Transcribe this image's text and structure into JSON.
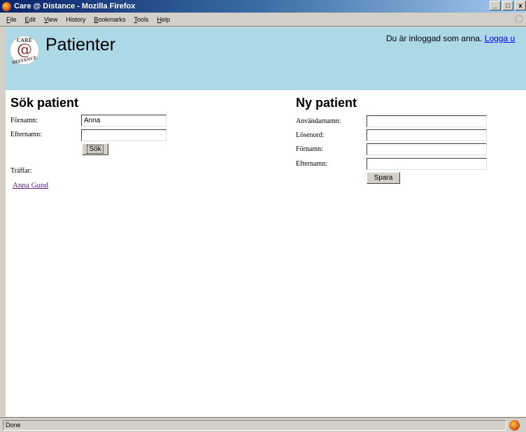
{
  "window": {
    "title": "Care @ Distance - Mozilla Firefox",
    "controls": [
      "_",
      "□",
      "x"
    ]
  },
  "menu": [
    {
      "label": "File",
      "key": "F",
      "rest": "ile"
    },
    {
      "label": "Edit",
      "key": "E",
      "rest": "dit"
    },
    {
      "label": "View",
      "key": "V",
      "rest": "iew"
    },
    {
      "label": "History",
      "key": "",
      "rest": "History"
    },
    {
      "label": "Bookmarks",
      "key": "B",
      "rest": "ookmarks"
    },
    {
      "label": "Tools",
      "key": "T",
      "rest": "ools"
    },
    {
      "label": "Help",
      "key": "H",
      "rest": "elp"
    }
  ],
  "header": {
    "logo_top": "CARE",
    "logo_symbol": "@",
    "logo_bottom": "DISTANCE",
    "title": "Patienter",
    "login_text": "Du är inloggad som anna.",
    "logout_link": "Logga u"
  },
  "search": {
    "heading": "Sök patient",
    "firstname_label": "Förnamn:",
    "firstname_value": "Anna",
    "lastname_label": "Efternamn:",
    "lastname_value": "",
    "button": "Sök",
    "results_label": "Träffar:",
    "results": [
      "Anna Gund"
    ]
  },
  "new_patient": {
    "heading": "Ny patient",
    "username_label": "Användarnamn:",
    "password_label": "Lösenord:",
    "firstname_label": "Förnamn:",
    "lastname_label": "Efternamn:",
    "button": "Spara"
  },
  "status": {
    "text": "Done"
  },
  "colors": {
    "header_bg": "#add8e6",
    "title_bar": "#0a246a",
    "link": "#0000ee",
    "visited_link": "#551a8b"
  }
}
